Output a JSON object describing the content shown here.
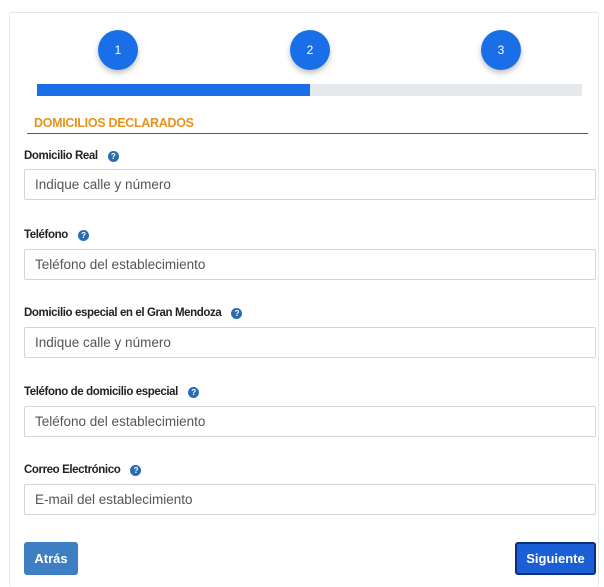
{
  "stepper": {
    "steps": [
      "1",
      "2",
      "3"
    ],
    "progress": 0.5
  },
  "section": {
    "title": "DOMICILIOS DECLARADOS"
  },
  "fields": [
    {
      "label": "Domicilio Real",
      "placeholder": "Indique calle y número"
    },
    {
      "label": "Teléfono",
      "placeholder": "Teléfono del establecimiento"
    },
    {
      "label": "Domicilio especial en el Gran Mendoza",
      "placeholder": "Indique calle y número"
    },
    {
      "label": "Teléfono de domicilio especial",
      "placeholder": "Teléfono del establecimiento"
    },
    {
      "label": "Correo Electrónico",
      "placeholder": "E-mail del establecimiento"
    }
  ],
  "help_glyph": "?",
  "buttons": {
    "back": "Atrás",
    "next": "Siguiente"
  }
}
